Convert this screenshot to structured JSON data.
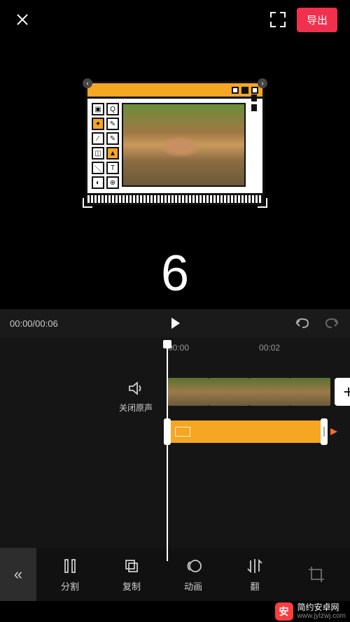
{
  "topbar": {
    "export_label": "导出"
  },
  "preview": {
    "countdown": "6"
  },
  "playbar": {
    "time_display": "00:00/00:06"
  },
  "timeline": {
    "ruler_marks": [
      "00:00",
      "00:02"
    ],
    "mute_label": "关闭原声"
  },
  "tools": {
    "items": [
      {
        "label": "分割",
        "icon": "split-icon"
      },
      {
        "label": "复制",
        "icon": "copy-icon"
      },
      {
        "label": "动画",
        "icon": "animation-icon"
      },
      {
        "label": "翻",
        "icon": "flip-icon"
      }
    ]
  },
  "watermark": {
    "badge": "安",
    "name": "简约安卓网",
    "url": "www.jylzwj.com"
  }
}
